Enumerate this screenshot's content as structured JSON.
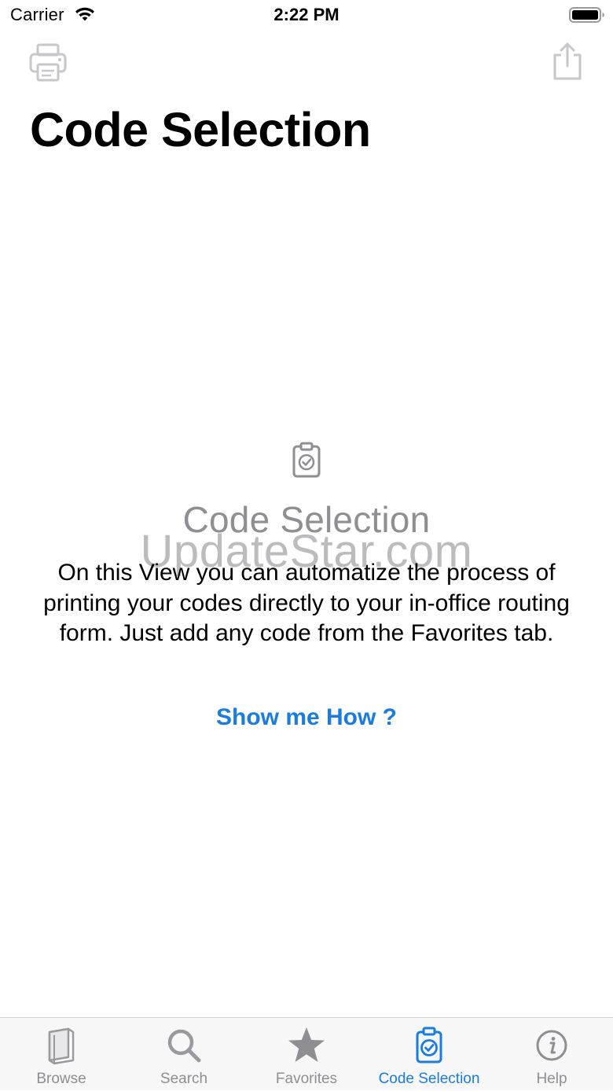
{
  "status_bar": {
    "carrier": "Carrier",
    "time": "2:22 PM",
    "wifi_icon": "wifi-icon",
    "battery_icon": "battery-icon"
  },
  "navbar": {
    "left_icon": "printer-icon",
    "right_icon": "share-icon",
    "large_title": "Code Selection"
  },
  "empty_state": {
    "icon": "clipboard-check-icon",
    "heading": "Code Selection",
    "watermark": "UpdateStar.com",
    "body": "On this View you can automatize the process of printing your codes directly to your in-office routing form. Just add any code from the Favorites tab.",
    "link": "Show me How ?"
  },
  "tab_bar": {
    "tabs": [
      {
        "label": "Browse",
        "icon": "book-icon",
        "active": false
      },
      {
        "label": "Search",
        "icon": "magnifier-icon",
        "active": false
      },
      {
        "label": "Favorites",
        "icon": "star-icon",
        "active": false
      },
      {
        "label": "Code Selection",
        "icon": "clipboard-check-icon",
        "active": true
      },
      {
        "label": "Help",
        "icon": "info-icon",
        "active": false
      }
    ]
  },
  "colors": {
    "accent": "#1a7be0",
    "inactive": "#8e8e93",
    "tabbar_bg": "#f7f7f7"
  }
}
